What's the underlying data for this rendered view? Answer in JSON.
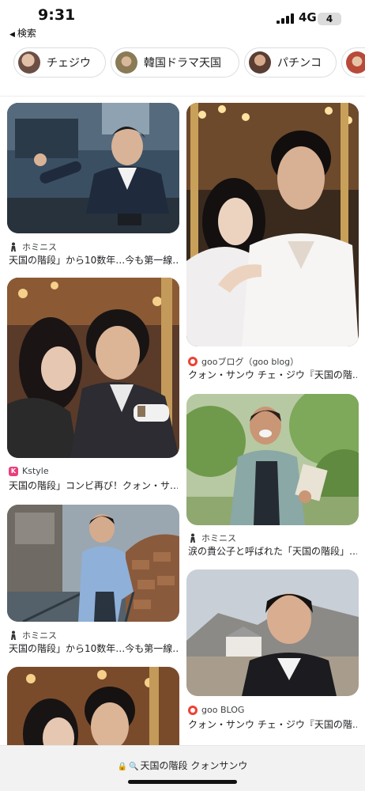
{
  "status_bar": {
    "time": "9:31",
    "back_app_label": "検索",
    "network": "4G",
    "battery": "4"
  },
  "chips": [
    {
      "label": "チェジウ",
      "avatar_color": "#6b4f45"
    },
    {
      "label": "韓国ドラマ天国",
      "avatar_color": "#8a7a55"
    },
    {
      "label": "パチンコ",
      "avatar_color": "#5a3e33"
    },
    {
      "label": "",
      "avatar_color": "#b84a3a"
    }
  ],
  "results": [
    {
      "source": "ホミニス",
      "source_icon": "person-icon",
      "caption": "天国の階段」から10数年…今も第一線…"
    },
    {
      "source": "Kstyle",
      "source_icon": "kstyle-icon",
      "caption": "天国の階段」コンビ再び！クォン・サ…"
    },
    {
      "source": "ホミニス",
      "source_icon": "person-icon",
      "caption": "天国の階段」から10数年…今も第一線…"
    },
    {
      "source": "gooブログ（goo blog）",
      "source_icon": "goo-icon",
      "caption": "クォン・サンウ チェ・ジウ『天国の階…"
    },
    {
      "source": "ホミニス",
      "source_icon": "person-icon",
      "caption": "涙の貴公子と呼ばれた「天国の階段」…"
    },
    {
      "source": "goo BLOG",
      "source_icon": "goo-icon",
      "caption": "クォン・サンウ チェ・ジウ『天国の階…"
    }
  ],
  "bottom_bar": {
    "url_text": "天国の階段 クォンサンウ"
  },
  "colors": {
    "chip_border": "#dadce0",
    "bottom_bar_bg": "#f2f2f2"
  }
}
